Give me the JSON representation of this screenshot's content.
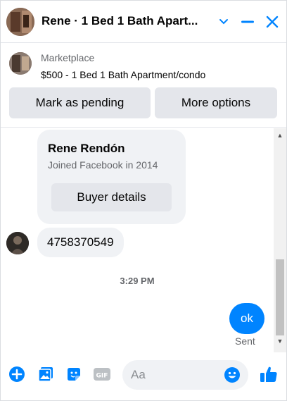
{
  "header": {
    "title": "Rene · 1 Bed 1 Bath Apart..."
  },
  "marketplace": {
    "label": "Marketplace",
    "listing": "$500 - 1 Bed 1 Bath Apartment/condo",
    "mark_pending_label": "Mark as pending",
    "more_options_label": "More options"
  },
  "conversation": {
    "buyer_card": {
      "name": "Rene Rendón",
      "joined": "Joined Facebook in 2014",
      "details_label": "Buyer details"
    },
    "incoming_message": "4758370549",
    "timestamp": "3:29 PM",
    "outgoing_message": "ok",
    "status": "Sent"
  },
  "composer": {
    "placeholder": "Aa"
  },
  "colors": {
    "accent": "#0084ff",
    "bubble_gray": "#f0f2f5",
    "button_gray": "#e4e6eb"
  },
  "icons": [
    "chevron-down-icon",
    "minimize-icon",
    "close-icon",
    "add-icon",
    "image-icon",
    "sticker-icon",
    "gif-icon",
    "emoji-icon",
    "like-icon"
  ]
}
